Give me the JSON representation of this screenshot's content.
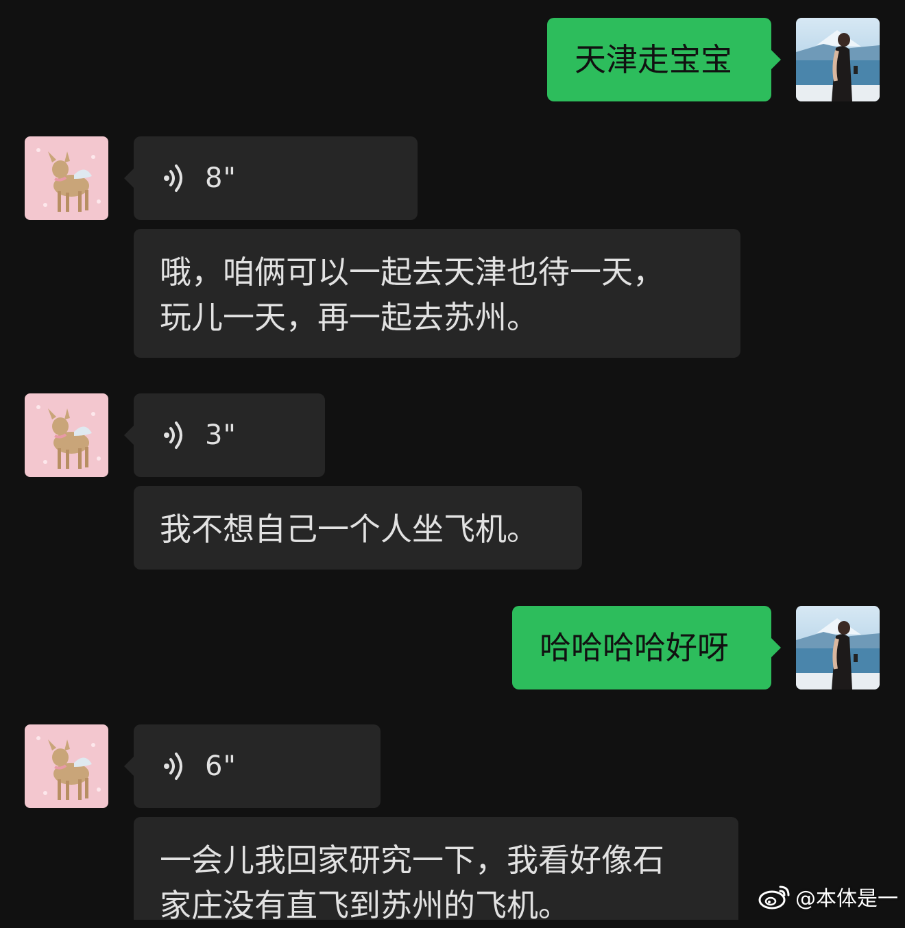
{
  "messages": [
    {
      "side": "sent",
      "type": "text",
      "text": "天津走宝宝"
    },
    {
      "side": "recv",
      "type": "voice",
      "duration": "8\""
    },
    {
      "side": "recv",
      "type": "text",
      "text": "哦，咱俩可以一起去天津也待一天，\n玩儿一天，再一起去苏州。"
    },
    {
      "side": "recv",
      "type": "voice",
      "duration": "3\""
    },
    {
      "side": "recv",
      "type": "text",
      "text": "我不想自己一个人坐飞机。"
    },
    {
      "side": "sent",
      "type": "text",
      "text": "哈哈哈哈好呀"
    },
    {
      "side": "recv",
      "type": "voice",
      "duration": "6\""
    },
    {
      "side": "recv",
      "type": "text",
      "text": "一会儿我回家研究一下，我看好像石\n家庄没有直飞到苏州的飞机。"
    }
  ],
  "watermark": {
    "text": "@本体是一"
  },
  "colors": {
    "background": "#111111",
    "received_bubble": "#262626",
    "sent_bubble": "#2dbd5c"
  },
  "icons": {
    "voice": "voice-wave-icon",
    "watermark": "weibo-logo-icon"
  }
}
